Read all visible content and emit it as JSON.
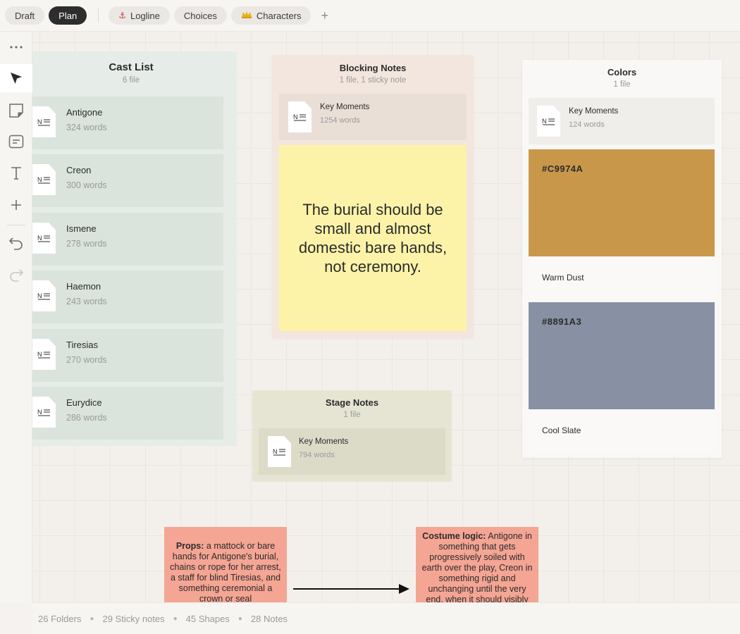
{
  "topbar": {
    "tabs": [
      {
        "label": "Draft",
        "active": false
      },
      {
        "label": "Plan",
        "active": true
      }
    ],
    "pinned": [
      {
        "label": "Logline",
        "icon": "anchor-icon"
      },
      {
        "label": "Choices",
        "icon": ""
      },
      {
        "label": "Characters",
        "icon": "crown-icon"
      }
    ],
    "add_label": "+"
  },
  "toolbar": {
    "more_label": "•••",
    "tools": [
      "more-icon",
      "cursor-icon",
      "sticky-note-icon",
      "card-icon",
      "text-icon",
      "add-icon",
      "undo-icon",
      "redo-icon"
    ]
  },
  "cast_list": {
    "title": "Cast List",
    "subtitle": "6 file",
    "items": [
      {
        "name": "Antigone",
        "words": "324 words"
      },
      {
        "name": "Creon",
        "words": "300 words"
      },
      {
        "name": "Ismene",
        "words": "278 words"
      },
      {
        "name": "Haemon",
        "words": "243 words"
      },
      {
        "name": "Tiresias",
        "words": "270 words"
      },
      {
        "name": "Eurydice",
        "words": "286 words"
      }
    ]
  },
  "blocking_notes": {
    "title": "Blocking Notes",
    "subtitle": "1 file, 1 sticky note",
    "file": {
      "name": "Key Moments",
      "words": "1254  words"
    },
    "sticky": "The burial should be small and almost domestic bare hands, not ceremony."
  },
  "stage_notes": {
    "title": "Stage Notes",
    "subtitle": "1 file",
    "file": {
      "name": "Key Moments",
      "words": "794 words"
    }
  },
  "colors_board": {
    "title": "Colors",
    "subtitle": "1 file",
    "file": {
      "name": "Key Moments",
      "words": "124 words"
    },
    "swatches": [
      {
        "hex": "#C9974A",
        "name": "Warm Dust",
        "color": "#C9974A"
      },
      {
        "hex": "#8891A3",
        "name": "Cool Slate",
        "color": "#8891A3"
      }
    ]
  },
  "notes": {
    "props": {
      "heading": "Props:",
      "text": " a mattock or bare hands for Antigone's burial, chains or rope for her arrest, a staff for blind Tiresias, and something ceremonial a crown or seal"
    },
    "costume": {
      "heading": "Costume logic:",
      "text": " Antigone in something that gets progressively soiled with earth over the play, Creon in something rigid and unchanging until the very end, when it should visibly"
    }
  },
  "status": {
    "folders": "26 Folders",
    "sticky_notes": "29 Sticky notes",
    "shapes": "45 Shapes",
    "notes": "28 Notes"
  }
}
